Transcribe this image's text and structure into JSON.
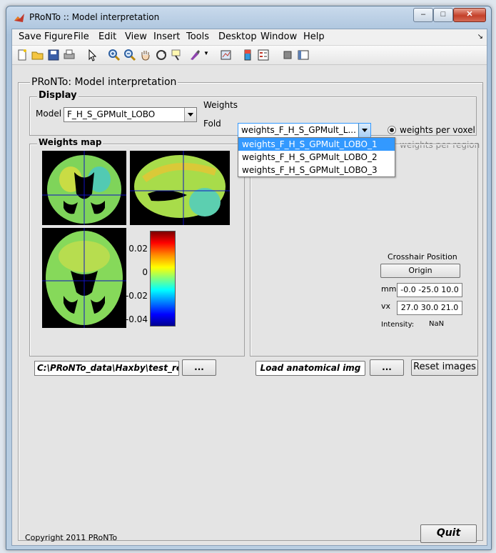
{
  "window": {
    "title": "PRoNTo :: Model interpretation"
  },
  "menu": [
    "Save Figure",
    "File",
    "Edit",
    "View",
    "Insert",
    "Tools",
    "Desktop",
    "Window",
    "Help"
  ],
  "panel": {
    "title": "PRoNTo: Model interpretation"
  },
  "display": {
    "title": "Display",
    "model_label": "Model",
    "model_value": "F_H_S_GPMult_LOBO",
    "weights_label": "Weights",
    "weights_value": "weights_F_H_S_GPMult_L...",
    "fold_label": "Fold",
    "weights_options": [
      "weights_F_H_S_GPMult_LOBO_1",
      "weights_F_H_S_GPMult_LOBO_2",
      "weights_F_H_S_GPMult_LOBO_3"
    ],
    "radio_voxel": "weights per voxel",
    "radio_region": "weights per region"
  },
  "weights_map": {
    "title": "Weights map",
    "colorbar_ticks": [
      "0.02",
      "0",
      "-0.02",
      "-0.04"
    ]
  },
  "crosshair": {
    "title": "Crosshair Position",
    "origin_button": "Origin",
    "mm_label": "mm",
    "mm_value": "-0.0 -25.0 10.0",
    "vx_label": "vx",
    "vx_value": "27.0 30.0 21.0",
    "intensity_label": "Intensity:",
    "intensity_value": "NaN"
  },
  "bottom": {
    "path_value": "C:\\PRoNTo_data\\Haxby\\test_results",
    "browse_button": "...",
    "load_button": "Load anatomical img",
    "browse2_button": "...",
    "reset_button": "Reset images"
  },
  "footer": {
    "copyright": "Copyright 2011 PRoNTo",
    "quit_button": "Quit"
  },
  "colors": {
    "selection": "#3399ff"
  }
}
